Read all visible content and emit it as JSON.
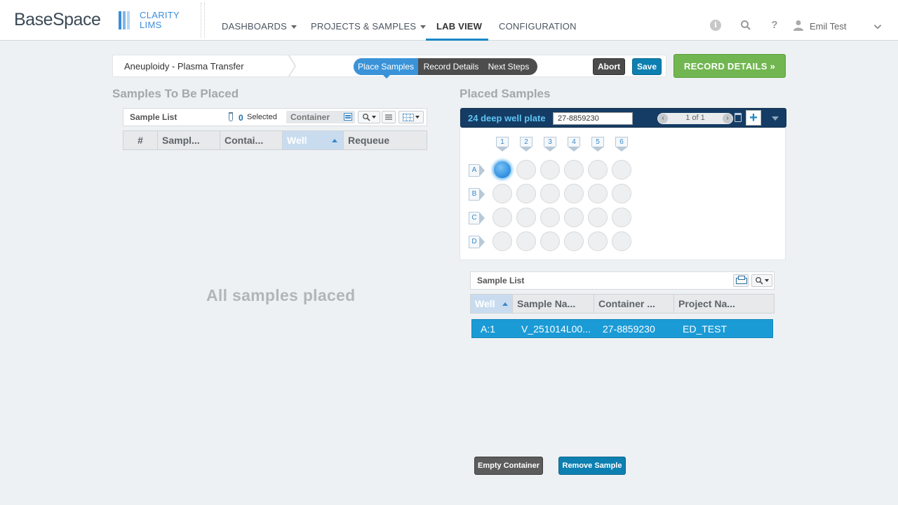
{
  "brand": {
    "base": "BaseSpace",
    "clarity": "CLARITY",
    "lims": "LIMS",
    "bar_colors": [
      "#3d8ddb",
      "#7cb7ea",
      "#b7d7f3"
    ]
  },
  "nav": {
    "items": [
      {
        "label": "DASHBOARDS",
        "has_caret": true
      },
      {
        "label": "PROJECTS & SAMPLES",
        "has_caret": true
      },
      {
        "label": "LAB VIEW",
        "active": true
      },
      {
        "label": "CONFIGURATION"
      }
    ],
    "icons": [
      "info-icon",
      "search-icon",
      "help-icon",
      "user-icon",
      "chevron-down-icon"
    ],
    "user_name": "Emil Test",
    "accent": "#1a87c6"
  },
  "step": {
    "name": "Aneuploidy - Plasma Transfer",
    "pills": [
      "Place Samples",
      "Record Details",
      "Next Steps"
    ],
    "active_pill": "Place Samples",
    "abort_label": "Abort",
    "save_label": "Save",
    "record_label": "RECORD DETAILS »"
  },
  "left": {
    "section_title": "Samples To Be Placed",
    "list_title": "Sample List",
    "selected_count": "0",
    "selected_label": "Selected",
    "container_label": "Container",
    "columns": [
      "#",
      "Sampl...",
      "Contai...",
      "Well",
      "Requeue"
    ],
    "sorted_column": "Well",
    "empty_message": "All samples placed"
  },
  "plate": {
    "section_title": "Placed Samples",
    "title": "24 deep well plate",
    "container_id": "27-8859230",
    "page_text": "1 of 1",
    "columns": [
      "1",
      "2",
      "3",
      "4",
      "5",
      "6"
    ],
    "rows": [
      "A",
      "B",
      "C",
      "D"
    ],
    "filled_wells": [
      "A:1"
    ]
  },
  "right": {
    "list_title": "Sample List",
    "columns": [
      "Well",
      "Sample Na...",
      "Container ...",
      "Project Na..."
    ],
    "sorted_column": "Well",
    "rows": [
      {
        "well": "A:1",
        "sample": "V_251014L00...",
        "container": "27-8859230",
        "project": "ED_TEST"
      }
    ],
    "selected_row_color": "#1b9bd6"
  },
  "bottom": {
    "empty_container_label": "Empty Container",
    "remove_sample_label": "Remove Sample"
  }
}
